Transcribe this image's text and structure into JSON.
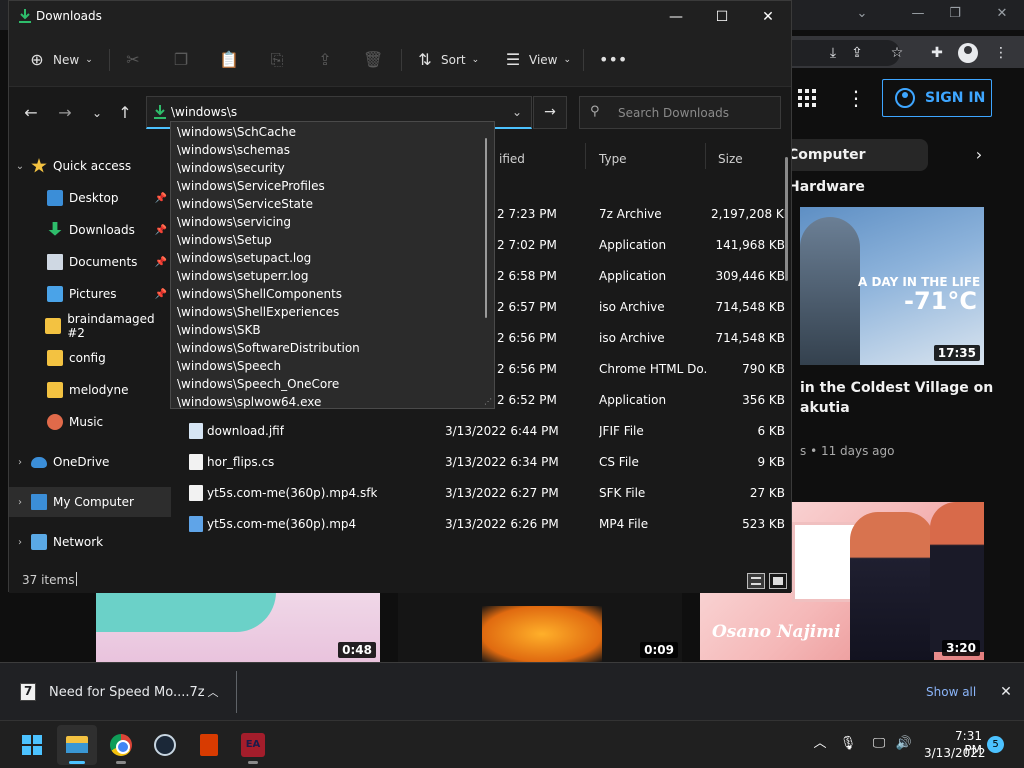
{
  "browser": {
    "sign_in_label": "SIGN IN",
    "chip_label": "Computer Hardware",
    "video1": {
      "overlay_line1": "A DAY IN THE LIFE",
      "overlay_line2": "-71°C",
      "duration": "17:35",
      "title": "in the Coldest Village on\nakutia",
      "meta": "s • 11 days ago"
    },
    "video2": {
      "overlay_text": "Osano Najimi",
      "duration": "3:20"
    },
    "video3": {
      "duration": "0:48"
    },
    "video4": {
      "duration": "0:09"
    }
  },
  "explorer": {
    "window_title": "Downloads",
    "ribbon": {
      "new_label": "New",
      "sort_label": "Sort",
      "view_label": "View"
    },
    "address_value": "\\windows\\s",
    "search_placeholder": "Search Downloads",
    "sidebar": [
      {
        "label": "Quick access",
        "icon": "star-icon",
        "expandable": true
      },
      {
        "label": "Desktop",
        "icon": "desktop-icon",
        "pinned": true
      },
      {
        "label": "Downloads",
        "icon": "download-icon",
        "pinned": true
      },
      {
        "label": "Documents",
        "icon": "document-icon",
        "pinned": true
      },
      {
        "label": "Pictures",
        "icon": "picture-icon",
        "pinned": true
      },
      {
        "label": "braindamaged #2",
        "icon": "folder-icon"
      },
      {
        "label": "config",
        "icon": "folder-icon"
      },
      {
        "label": "melodyne",
        "icon": "folder-icon"
      },
      {
        "label": "Music",
        "icon": "music-icon"
      },
      {
        "label": "OneDrive",
        "icon": "cloud-icon",
        "expandable": true
      },
      {
        "label": "My Computer",
        "icon": "monitor-icon",
        "expandable": true,
        "selected": true
      },
      {
        "label": "Network",
        "icon": "network-icon",
        "expandable": true
      }
    ],
    "columns": {
      "date_partial": "ified",
      "type": "Type",
      "size": "Size"
    },
    "rows": [
      {
        "name": "",
        "date": "2 7:23 PM",
        "type": "7z Archive",
        "size": "2,197,208 KB"
      },
      {
        "name": "",
        "date": "2 7:02 PM",
        "type": "Application",
        "size": "141,968 KB"
      },
      {
        "name": "",
        "date": "2 6:58 PM",
        "type": "Application",
        "size": "309,446 KB"
      },
      {
        "name": "",
        "date": "2 6:57 PM",
        "type": "iso Archive",
        "size": "714,548 KB"
      },
      {
        "name": "",
        "date": "2 6:56 PM",
        "type": "iso Archive",
        "size": "714,548 KB"
      },
      {
        "name": "",
        "date": "2 6:56 PM",
        "type": "Chrome HTML Do...",
        "size": "790 KB"
      },
      {
        "name": "",
        "date": "2 6:52 PM",
        "type": "Application",
        "size": "356 KB"
      },
      {
        "name": "download.jfif",
        "date": "3/13/2022 6:44 PM",
        "type": "JFIF File",
        "size": "6 KB"
      },
      {
        "name": "hor_flips.cs",
        "date": "3/13/2022 6:34 PM",
        "type": "CS File",
        "size": "9 KB"
      },
      {
        "name": "yt5s.com-me(360p).mp4.sfk",
        "date": "3/13/2022 6:27 PM",
        "type": "SFK File",
        "size": "27 KB"
      },
      {
        "name": "yt5s.com-me(360p).mp4",
        "date": "3/13/2022 6:26 PM",
        "type": "MP4 File",
        "size": "523 KB"
      }
    ],
    "autocomplete": [
      "\\windows\\SchCache",
      "\\windows\\schemas",
      "\\windows\\security",
      "\\windows\\ServiceProfiles",
      "\\windows\\ServiceState",
      "\\windows\\servicing",
      "\\windows\\Setup",
      "\\windows\\setupact.log",
      "\\windows\\setuperr.log",
      "\\windows\\ShellComponents",
      "\\windows\\ShellExperiences",
      "\\windows\\SKB",
      "\\windows\\SoftwareDistribution",
      "\\windows\\Speech",
      "\\windows\\Speech_OneCore",
      "\\windows\\splwow64.exe"
    ],
    "status_count": "37 items"
  },
  "download_bar": {
    "file_name": "Need for Speed Mo....7z",
    "show_all_label": "Show all"
  },
  "taskbar": {
    "time": "7:31 PM",
    "date": "3/13/2022",
    "notification_count": "5",
    "ea_label": "EA"
  },
  "colors": {
    "accent": "#4cc2ff",
    "youtube_blue": "#3ea6ff",
    "folder": "#f3c241",
    "download_green": "#2ebd6b"
  }
}
